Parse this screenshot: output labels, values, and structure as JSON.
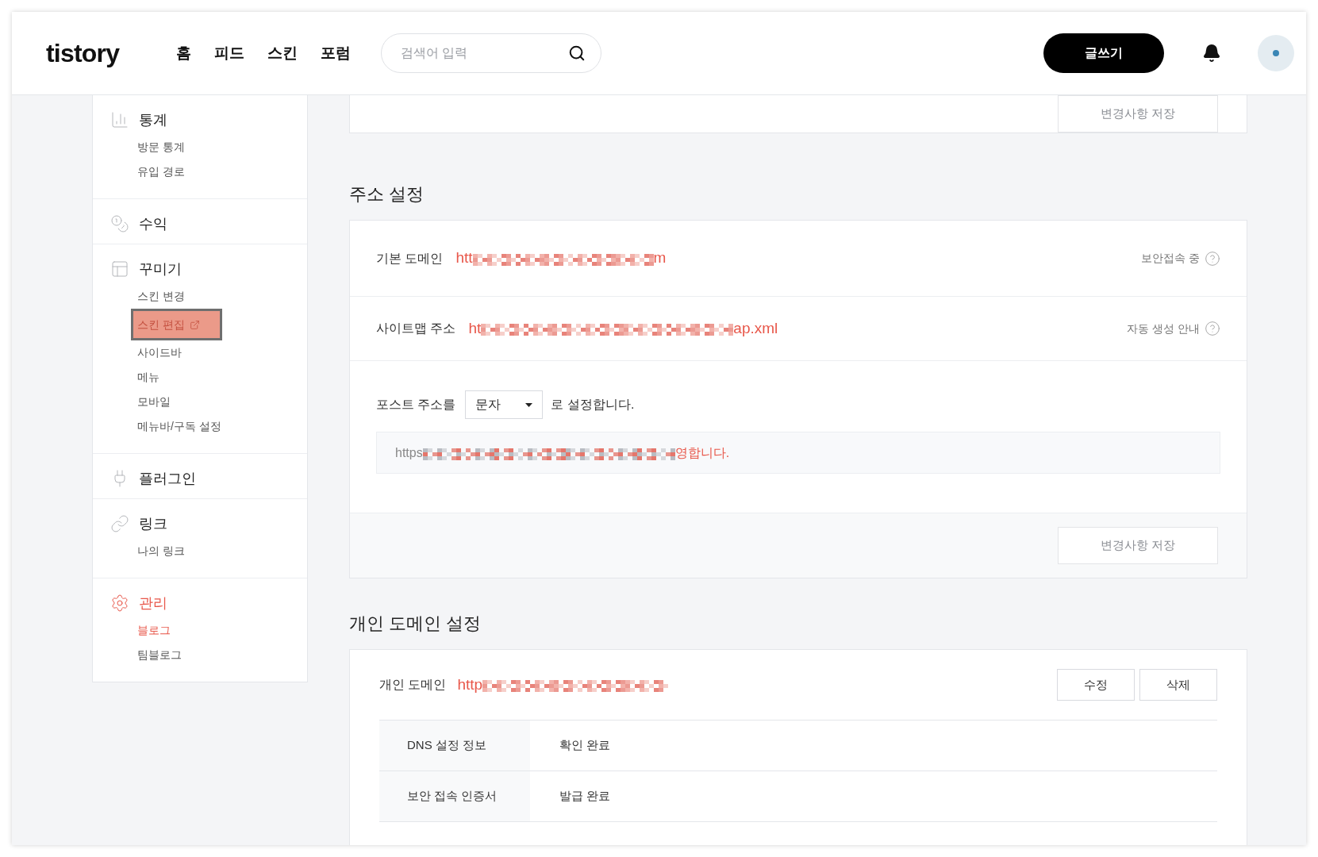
{
  "header": {
    "logo": "tistory",
    "nav": [
      {
        "label": "홈"
      },
      {
        "label": "피드"
      },
      {
        "label": "스킨"
      },
      {
        "label": "포럼"
      }
    ],
    "search": {
      "placeholder": "검색어 입력"
    },
    "write_button": "글쓰기"
  },
  "sidebar": {
    "sections": [
      {
        "title": "통계",
        "selected": false,
        "items": [
          {
            "label": "방문 통계",
            "selected": false,
            "highlighted": false,
            "external": false
          },
          {
            "label": "유입 경로",
            "selected": false,
            "highlighted": false,
            "external": false
          }
        ]
      },
      {
        "title": "수익",
        "selected": false
      },
      {
        "title": "꾸미기",
        "selected": false,
        "items": [
          {
            "label": "스킨 변경",
            "selected": false,
            "highlighted": false,
            "external": false
          },
          {
            "label": "스킨 편집",
            "selected": false,
            "highlighted": true,
            "external": true
          },
          {
            "label": "사이드바",
            "selected": false,
            "highlighted": false,
            "external": false
          },
          {
            "label": "메뉴",
            "selected": false,
            "highlighted": false,
            "external": false
          },
          {
            "label": "모바일",
            "selected": false,
            "highlighted": false,
            "external": false
          },
          {
            "label": "메뉴바/구독 설정",
            "selected": false,
            "highlighted": false,
            "external": false
          }
        ]
      },
      {
        "title": "플러그인",
        "selected": false
      },
      {
        "title": "링크",
        "selected": false,
        "items": [
          {
            "label": "나의 링크",
            "selected": false,
            "highlighted": false,
            "external": false
          }
        ]
      },
      {
        "title": "관리",
        "selected": true,
        "items": [
          {
            "label": "블로그",
            "selected": true,
            "highlighted": false,
            "external": false
          },
          {
            "label": "팀블로그",
            "selected": false,
            "highlighted": false,
            "external": false
          }
        ]
      }
    ]
  },
  "top_card": {
    "save_button": "변경사항 저장"
  },
  "address": {
    "heading": "주소 설정",
    "rows": [
      {
        "label": "기본 도메인",
        "url_start": "htt",
        "url_end": "m",
        "note": "보안접속 중"
      },
      {
        "label": "사이트맵 주소",
        "url_start": "ht",
        "url_end": "ap.xml",
        "note": "자동 생성 안내"
      }
    ],
    "post": {
      "prefix": "포스트 주소를",
      "select": "문자",
      "suffix": "로 설정합니다."
    },
    "preview": {
      "start": "https",
      "end": "영합니다."
    },
    "save_button": "변경사항 저장"
  },
  "custom_domain": {
    "heading": "개인 도메인 설정",
    "label": "개인 도메인",
    "url_start": "http",
    "buttons": [
      "수정",
      "삭제"
    ],
    "table": [
      {
        "name": "DNS 설정 정보",
        "value": "확인 완료"
      },
      {
        "name": "보안 접속 인증서",
        "value": "발급 완료"
      }
    ]
  }
}
